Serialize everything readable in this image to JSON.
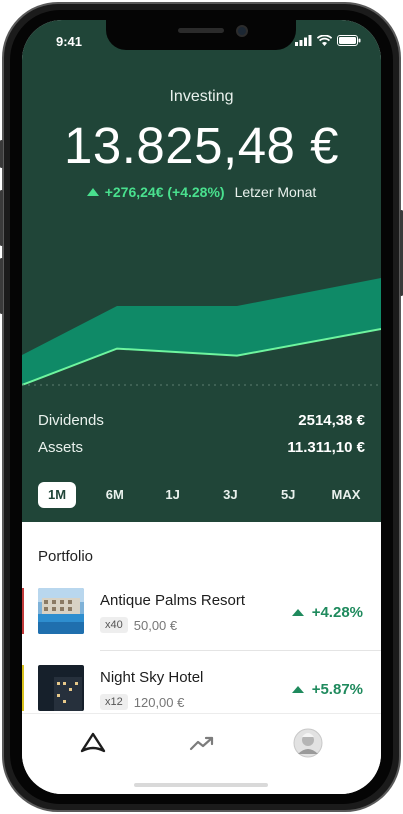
{
  "status_bar": {
    "time": "9:41"
  },
  "header": {
    "title": "Investing",
    "total": "13.825,48 €",
    "change": "+276,24€ (+4.28%)",
    "period": "Letzer Monat"
  },
  "colors": {
    "primary": "#204538",
    "accent": "#49e08e",
    "area": "#0f8a67",
    "gain": "#1f8a5d"
  },
  "chart_data": {
    "type": "area",
    "points": [
      0.0,
      0.35,
      0.35,
      0.55
    ],
    "line": [
      0.0,
      0.26,
      0.21,
      0.4
    ],
    "range": "1M"
  },
  "stats": [
    {
      "label": "Dividends",
      "value": "2514,38 €"
    },
    {
      "label": "Assets",
      "value": "11.311,10 €"
    }
  ],
  "ranges": [
    "1M",
    "6M",
    "1J",
    "3J",
    "5J",
    "MAX"
  ],
  "active_range": "1M",
  "portfolio": {
    "title": "Portfolio",
    "items": [
      {
        "name": "Antique Palms Resort",
        "qty": "x40",
        "price": "50,00 €",
        "change": "+4.28%"
      },
      {
        "name": "Night Sky Hotel",
        "qty": "x12",
        "price": "120,00 €",
        "change": "+5.87%"
      }
    ]
  },
  "tabbar": {
    "icons": [
      "home-icon",
      "trend-icon",
      "profile-avatar"
    ]
  }
}
